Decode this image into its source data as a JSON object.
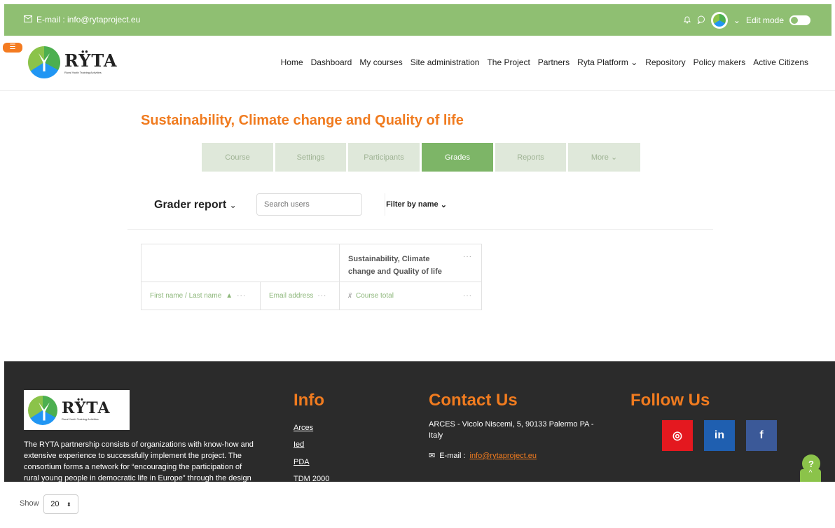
{
  "topbar": {
    "email_label": "E-mail : info@rytaproject.eu",
    "edit_mode_label": "Edit mode"
  },
  "header": {
    "logo_text": "RŸTA",
    "logo_subtext": "Rural Youth Training Activities",
    "nav": [
      "Home",
      "Dashboard",
      "My courses",
      "Site administration",
      "The Project",
      "Partners",
      "Ryta Platform",
      "Repository",
      "Policy makers",
      "Active Citizens"
    ]
  },
  "course": {
    "title": "Sustainability, Climate change and Quality of life",
    "tabs": [
      "Course",
      "Settings",
      "Participants",
      "Grades",
      "Reports",
      "More"
    ],
    "active_tab": "Grades"
  },
  "grader": {
    "title": "Grader report",
    "search_placeholder": "Search users",
    "filter_label": "Filter by name"
  },
  "table": {
    "course_header_line1": "Sustainability, Climate",
    "course_header_line2": "change and Quality of life",
    "col_name": "First name / Last name",
    "col_email": "Email address",
    "col_total": "Course total",
    "dots": "···"
  },
  "footer": {
    "about_text_1": "The RYTA partnership consists of organizations with know-how and",
    "about_text_2": "extensive experience to successfully implement the project. The",
    "about_text_3": "consortium forms a network for “encouraging the participation of",
    "about_text_4": "rural young people in democratic life in Europe” through the design",
    "info_title": "Info",
    "info_links": [
      "Arces",
      "Ied",
      "PDA",
      "TDM 2000"
    ],
    "contact_title": "Contact Us",
    "contact_address_1": "ARCES - Vicolo Niscemi, 5, 90133 Palermo PA -",
    "contact_address_2": "Italy",
    "contact_email_label": "E-mail :",
    "contact_email": "info@rytaproject.eu",
    "follow_title": "Follow Us",
    "social": [
      {
        "name": "instagram",
        "glyph": "◎",
        "color": "#e4181f"
      },
      {
        "name": "linkedin",
        "glyph": "in",
        "color": "#1f5fb0"
      },
      {
        "name": "facebook",
        "glyph": "f",
        "color": "#3b5998"
      }
    ]
  },
  "pagination": {
    "show_label": "Show",
    "show_value": "20"
  },
  "help": {
    "glyph": "?",
    "up_glyph": "^"
  }
}
